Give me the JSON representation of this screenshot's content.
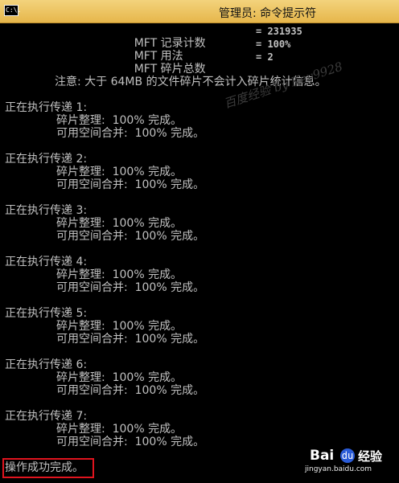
{
  "window": {
    "icon_text": "C:\\.",
    "title": "管理员: 命令提示符"
  },
  "stats": [
    {
      "label": "MFT 记录计数",
      "value": "= 231935"
    },
    {
      "label": "MFT 用法",
      "value": "= 100%"
    },
    {
      "label": "MFT 碎片总数",
      "value": "= 2"
    }
  ],
  "note": "注意: 大于 64MB 的文件碎片不会计入碎片统计信息。",
  "passes": [
    {
      "header": "正在执行传递 1:",
      "defrag": "碎片整理:  100% 完成。",
      "consolidate": "可用空间合并:  100% 完成。"
    },
    {
      "header": "正在执行传递 2:",
      "defrag": "碎片整理:  100% 完成。",
      "consolidate": "可用空间合并:  100% 完成。"
    },
    {
      "header": "正在执行传递 3:",
      "defrag": "碎片整理:  100% 完成。",
      "consolidate": "可用空间合并:  100% 完成。"
    },
    {
      "header": "正在执行传递 4:",
      "defrag": "碎片整理:  100% 完成。",
      "consolidate": "可用空间合并:  100% 完成。"
    },
    {
      "header": "正在执行传递 5:",
      "defrag": "碎片整理:  100% 完成。",
      "consolidate": "可用空间合并:  100% 完成。"
    },
    {
      "header": "正在执行传递 6:",
      "defrag": "碎片整理:  100% 完成。",
      "consolidate": "可用空间合并:  100% 完成。"
    },
    {
      "header": "正在执行传递 7:",
      "defrag": "碎片整理:  100% 完成。",
      "consolidate": "可用空间合并:  100% 完成。"
    }
  ],
  "success": "操作成功完成。",
  "watermark": "百度经验 by Key9928",
  "brand": {
    "baidu": "Bai",
    "paw": "du",
    "jingyan": "经验",
    "domain": "jingyan.baidu.com"
  },
  "colors": {
    "titlebar": "#e6b64b",
    "console_bg": "#000000",
    "console_text": "#c0c0c0",
    "highlight": "#e0141e"
  }
}
